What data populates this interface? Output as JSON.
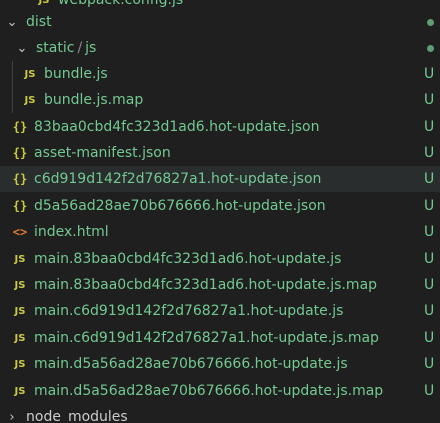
{
  "explorer": {
    "top_partial": {
      "label": "webpack.config.js",
      "badge": ""
    },
    "dist": {
      "label": "dist"
    },
    "static": {
      "part1": "static",
      "separator": "/",
      "part2": "js"
    },
    "items": [
      {
        "label": "bundle.js",
        "icon": "js-file-icon",
        "glyph": "JS",
        "badge": "U"
      },
      {
        "label": "bundle.js.map",
        "icon": "js-file-icon",
        "glyph": "JS",
        "badge": "U"
      },
      {
        "label": "83baa0cbd4fc323d1ad6.hot-update.json",
        "icon": "json-file-icon",
        "glyph": "{}",
        "badge": "U"
      },
      {
        "label": "asset-manifest.json",
        "icon": "json-file-icon",
        "glyph": "{}",
        "badge": "U"
      },
      {
        "label": "c6d919d142f2d76827a1.hot-update.json",
        "icon": "json-file-icon",
        "glyph": "{}",
        "badge": "U"
      },
      {
        "label": "d5a56ad28ae70b676666.hot-update.json",
        "icon": "json-file-icon",
        "glyph": "{}",
        "badge": "U"
      },
      {
        "label": "index.html",
        "icon": "html-file-icon",
        "glyph": "<>",
        "badge": "U"
      },
      {
        "label": "main.83baa0cbd4fc323d1ad6.hot-update.js",
        "icon": "js-file-icon",
        "glyph": "JS",
        "badge": "U"
      },
      {
        "label": "main.83baa0cbd4fc323d1ad6.hot-update.js.map",
        "icon": "js-file-icon",
        "glyph": "JS",
        "badge": "U"
      },
      {
        "label": "main.c6d919d142f2d76827a1.hot-update.js",
        "icon": "js-file-icon",
        "glyph": "JS",
        "badge": "U"
      },
      {
        "label": "main.c6d919d142f2d76827a1.hot-update.js.map",
        "icon": "js-file-icon",
        "glyph": "JS",
        "badge": "U"
      },
      {
        "label": "main.d5a56ad28ae70b676666.hot-update.js",
        "icon": "js-file-icon",
        "glyph": "JS",
        "badge": "U"
      },
      {
        "label": "main.d5a56ad28ae70b676666.hot-update.js.map",
        "icon": "js-file-icon",
        "glyph": "JS",
        "badge": "U"
      }
    ],
    "node_modules": {
      "label": "node_modules"
    },
    "colors": {
      "untracked": "#73c991",
      "background": "#1f1f1f",
      "hover": "#2a2d2e",
      "js_icon": "#cbcb41",
      "html_icon": "#e37933"
    }
  }
}
